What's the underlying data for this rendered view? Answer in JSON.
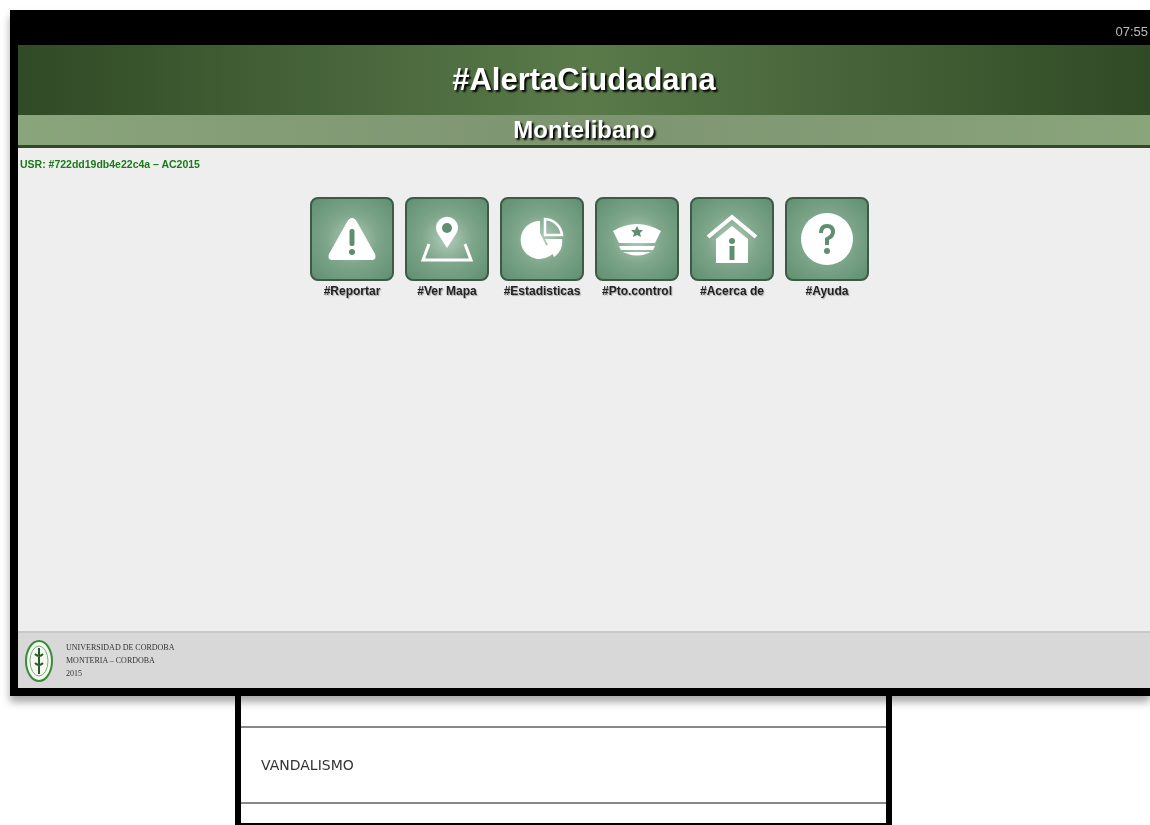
{
  "status_bar": {
    "time": "07:55"
  },
  "header": {
    "title": "#AlertaCiudadana",
    "subtitle": "Montelibano"
  },
  "user_id": "USR: #722dd19db4e22c4a – AC2015",
  "menu": [
    {
      "kind": "warning",
      "label": "#Reportar"
    },
    {
      "kind": "map",
      "label": "#Ver Mapa"
    },
    {
      "kind": "pie",
      "label": "#Estadisticas"
    },
    {
      "kind": "cap",
      "label": "#Pto.control"
    },
    {
      "kind": "house",
      "label": "#Acerca de"
    },
    {
      "kind": "help",
      "label": "#Ayuda"
    }
  ],
  "footer": {
    "lines": [
      "UNIVERSIDAD DE CORDOBA",
      "MONTERIA – CORDOBA",
      "2015"
    ]
  },
  "list": {
    "items": [
      "VANDALISMO"
    ]
  }
}
